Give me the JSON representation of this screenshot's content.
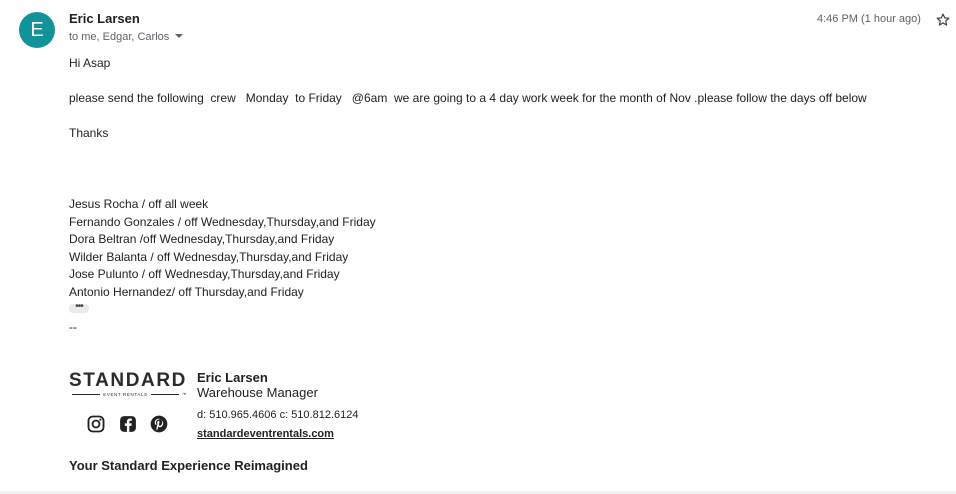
{
  "message": {
    "sender_initial": "E",
    "sender_name": "Eric Larsen",
    "recipients": "to me, Edgar, Carlos",
    "timestamp": "4:46 PM (1 hour ago)",
    "avatar_color": "#12939a",
    "star_icon": "star-outline-icon"
  },
  "body": {
    "greeting": "Hi Asap",
    "request": "please send the following  crew   Monday  to Friday   @6am  we are going to a 4 day work week for the month of Nov .please follow the days off below",
    "closing": "Thanks",
    "crew": [
      "Jesus Rocha / off all week",
      "Fernando Gonzales / off Wednesday,Thursday,and Friday",
      "Dora Beltran /off Wednesday,Thursday,and Friday",
      "Wilder Balanta / off Wednesday,Thursday,and Friday",
      "Jose Pulunto / off Wednesday,Thursday,and Friday",
      "Antonio Hernandez/ off Thursday,and Friday"
    ],
    "ellipsis": "•••",
    "sig_separator": "--"
  },
  "signature": {
    "logo_word": "STANDARD",
    "logo_sub": "EVENT RENTALS",
    "logo_tm": "™",
    "name": "Eric Larsen",
    "title": "Warehouse Manager",
    "phones": "d: 510.965.4606 c: 510.812.6124",
    "website": "standardeventrentals.com",
    "tagline": "Your Standard Experience Reimagined",
    "social_icons": [
      "instagram-icon",
      "facebook-icon",
      "pinterest-icon"
    ]
  }
}
